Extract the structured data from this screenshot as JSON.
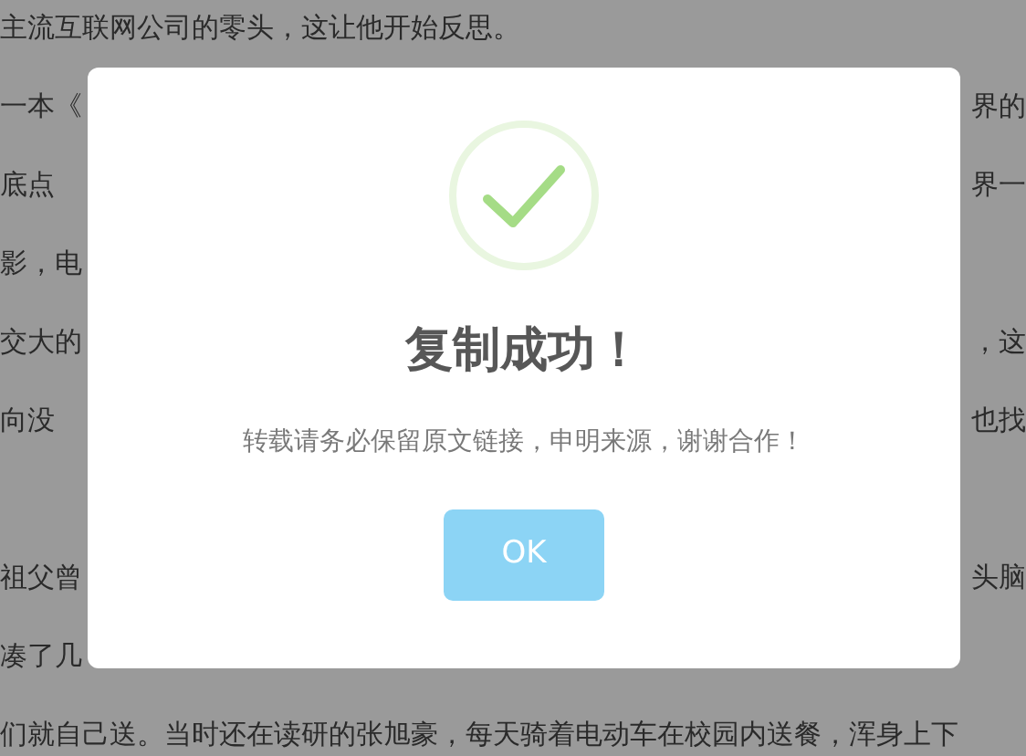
{
  "article": {
    "lines": [
      {
        "left": "主流互联网公司的零头，这让他开始反思。"
      },
      {
        "left": "一本《",
        "right": "界的"
      },
      {
        "left": "底点",
        "right": "界一"
      },
      {
        "left": "影，电"
      },
      {
        "left": "交大的",
        "right": "，这"
      },
      {
        "left": "向没",
        "right": "也找"
      },
      {
        "left": "祖父曾",
        "right": "头脑",
        "blank_line_before": true
      },
      {
        "left": "凑了几"
      },
      {
        "left": "们就自己送。当时还在读研的张旭豪，每天骑着电动车在校园内送餐，浑身上下"
      }
    ]
  },
  "dialog": {
    "title": "复制成功！",
    "message": "转载请务必保留原文链接，申明来源，谢谢合作！",
    "button": "OK"
  }
}
